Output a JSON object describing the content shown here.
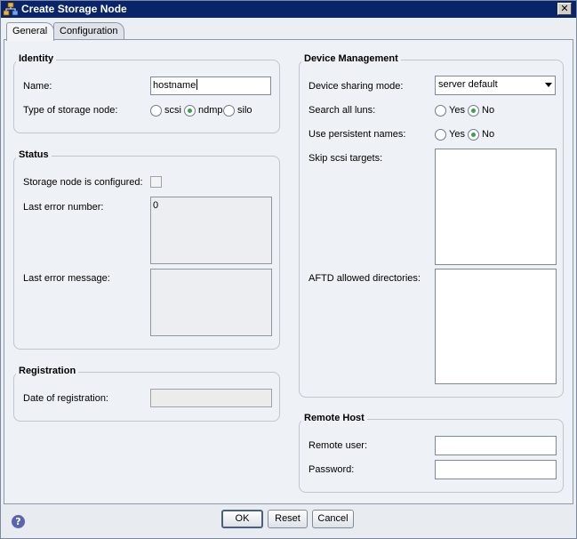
{
  "window": {
    "title": "Create Storage Node",
    "close_glyph": "✕"
  },
  "tabs": [
    {
      "label": "General",
      "active": true
    },
    {
      "label": "Configuration",
      "active": false
    }
  ],
  "identity": {
    "title": "Identity",
    "name_label": "Name:",
    "name_value": "hostname",
    "type_label": "Type of storage node:",
    "type_options": [
      "scsi",
      "ndmp",
      "silo"
    ],
    "type_selected": "ndmp"
  },
  "status": {
    "title": "Status",
    "configured_label": "Storage node is configured:",
    "configured_checked": false,
    "last_error_number_label": "Last error number:",
    "last_error_number_value": "0",
    "last_error_message_label": "Last error message:",
    "last_error_message_value": ""
  },
  "registration": {
    "title": "Registration",
    "date_label": "Date of registration:",
    "date_value": ""
  },
  "device_management": {
    "title": "Device Management",
    "sharing_label": "Device sharing mode:",
    "sharing_value": "server default",
    "search_luns_label": "Search all luns:",
    "search_luns_options": [
      "Yes",
      "No"
    ],
    "search_luns_selected": "No",
    "persistent_label": "Use persistent names:",
    "persistent_options": [
      "Yes",
      "No"
    ],
    "persistent_selected": "No",
    "skip_targets_label": "Skip scsi targets:",
    "skip_targets_value": "",
    "aftd_label": "AFTD allowed directories:",
    "aftd_value": ""
  },
  "remote_host": {
    "title": "Remote Host",
    "user_label": "Remote user:",
    "user_value": "",
    "password_label": "Password:",
    "password_value": ""
  },
  "footer": {
    "help_glyph": "?",
    "ok_label": "OK",
    "reset_label": "Reset",
    "cancel_label": "Cancel"
  },
  "colors": {
    "titlebar": "#0a246a",
    "radio_selected": "#37a34a",
    "panel_bg": "#eef1f5"
  }
}
